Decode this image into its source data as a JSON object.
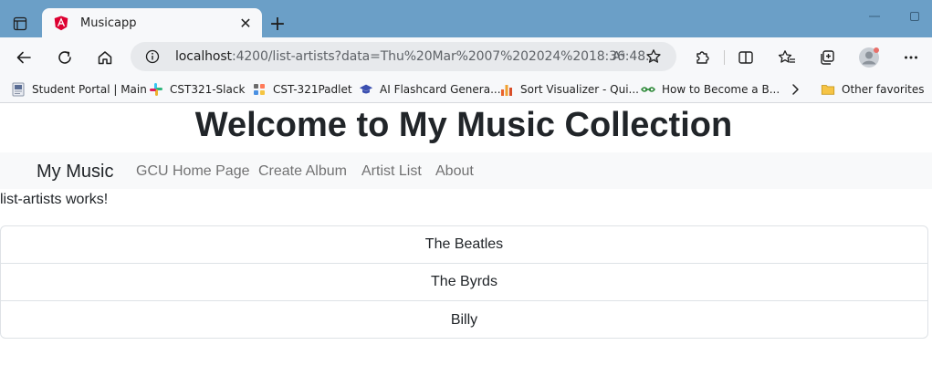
{
  "browser": {
    "tab_title": "Musicapp",
    "address": {
      "host": "localhost",
      "path": ":4200/list-artists?data=Thu%20Mar%2007%202024%2018:36:48..."
    },
    "bookmarks": [
      {
        "label": "Student Portal | Main",
        "icon": "student-portal-icon"
      },
      {
        "label": "CST321-Slack",
        "icon": "slack-icon"
      },
      {
        "label": "CST-321Padlet",
        "icon": "padlet-icon"
      },
      {
        "label": "AI Flashcard Genera...",
        "icon": "graduation-cap-icon"
      },
      {
        "label": "Sort Visualizer - Qui...",
        "icon": "bar-chart-icon"
      },
      {
        "label": "How to Become a B...",
        "icon": "link-icon"
      }
    ],
    "other_favorites": "Other favorites",
    "read_aloud_glyph": "Aᵃ",
    "colors": {
      "titlebar": "#6b9fc7",
      "toolbar": "#f7f8fa",
      "angular_red": "#dd0031"
    }
  },
  "page": {
    "heading": "Welcome to My Music Collection",
    "navbar": {
      "brand": "My Music",
      "links": [
        "GCU Home Page",
        "Create Album",
        "Artist List",
        "About"
      ]
    },
    "component_text": "list-artists works!",
    "artists": [
      "The Beatles",
      "The Byrds",
      "Billy"
    ]
  }
}
